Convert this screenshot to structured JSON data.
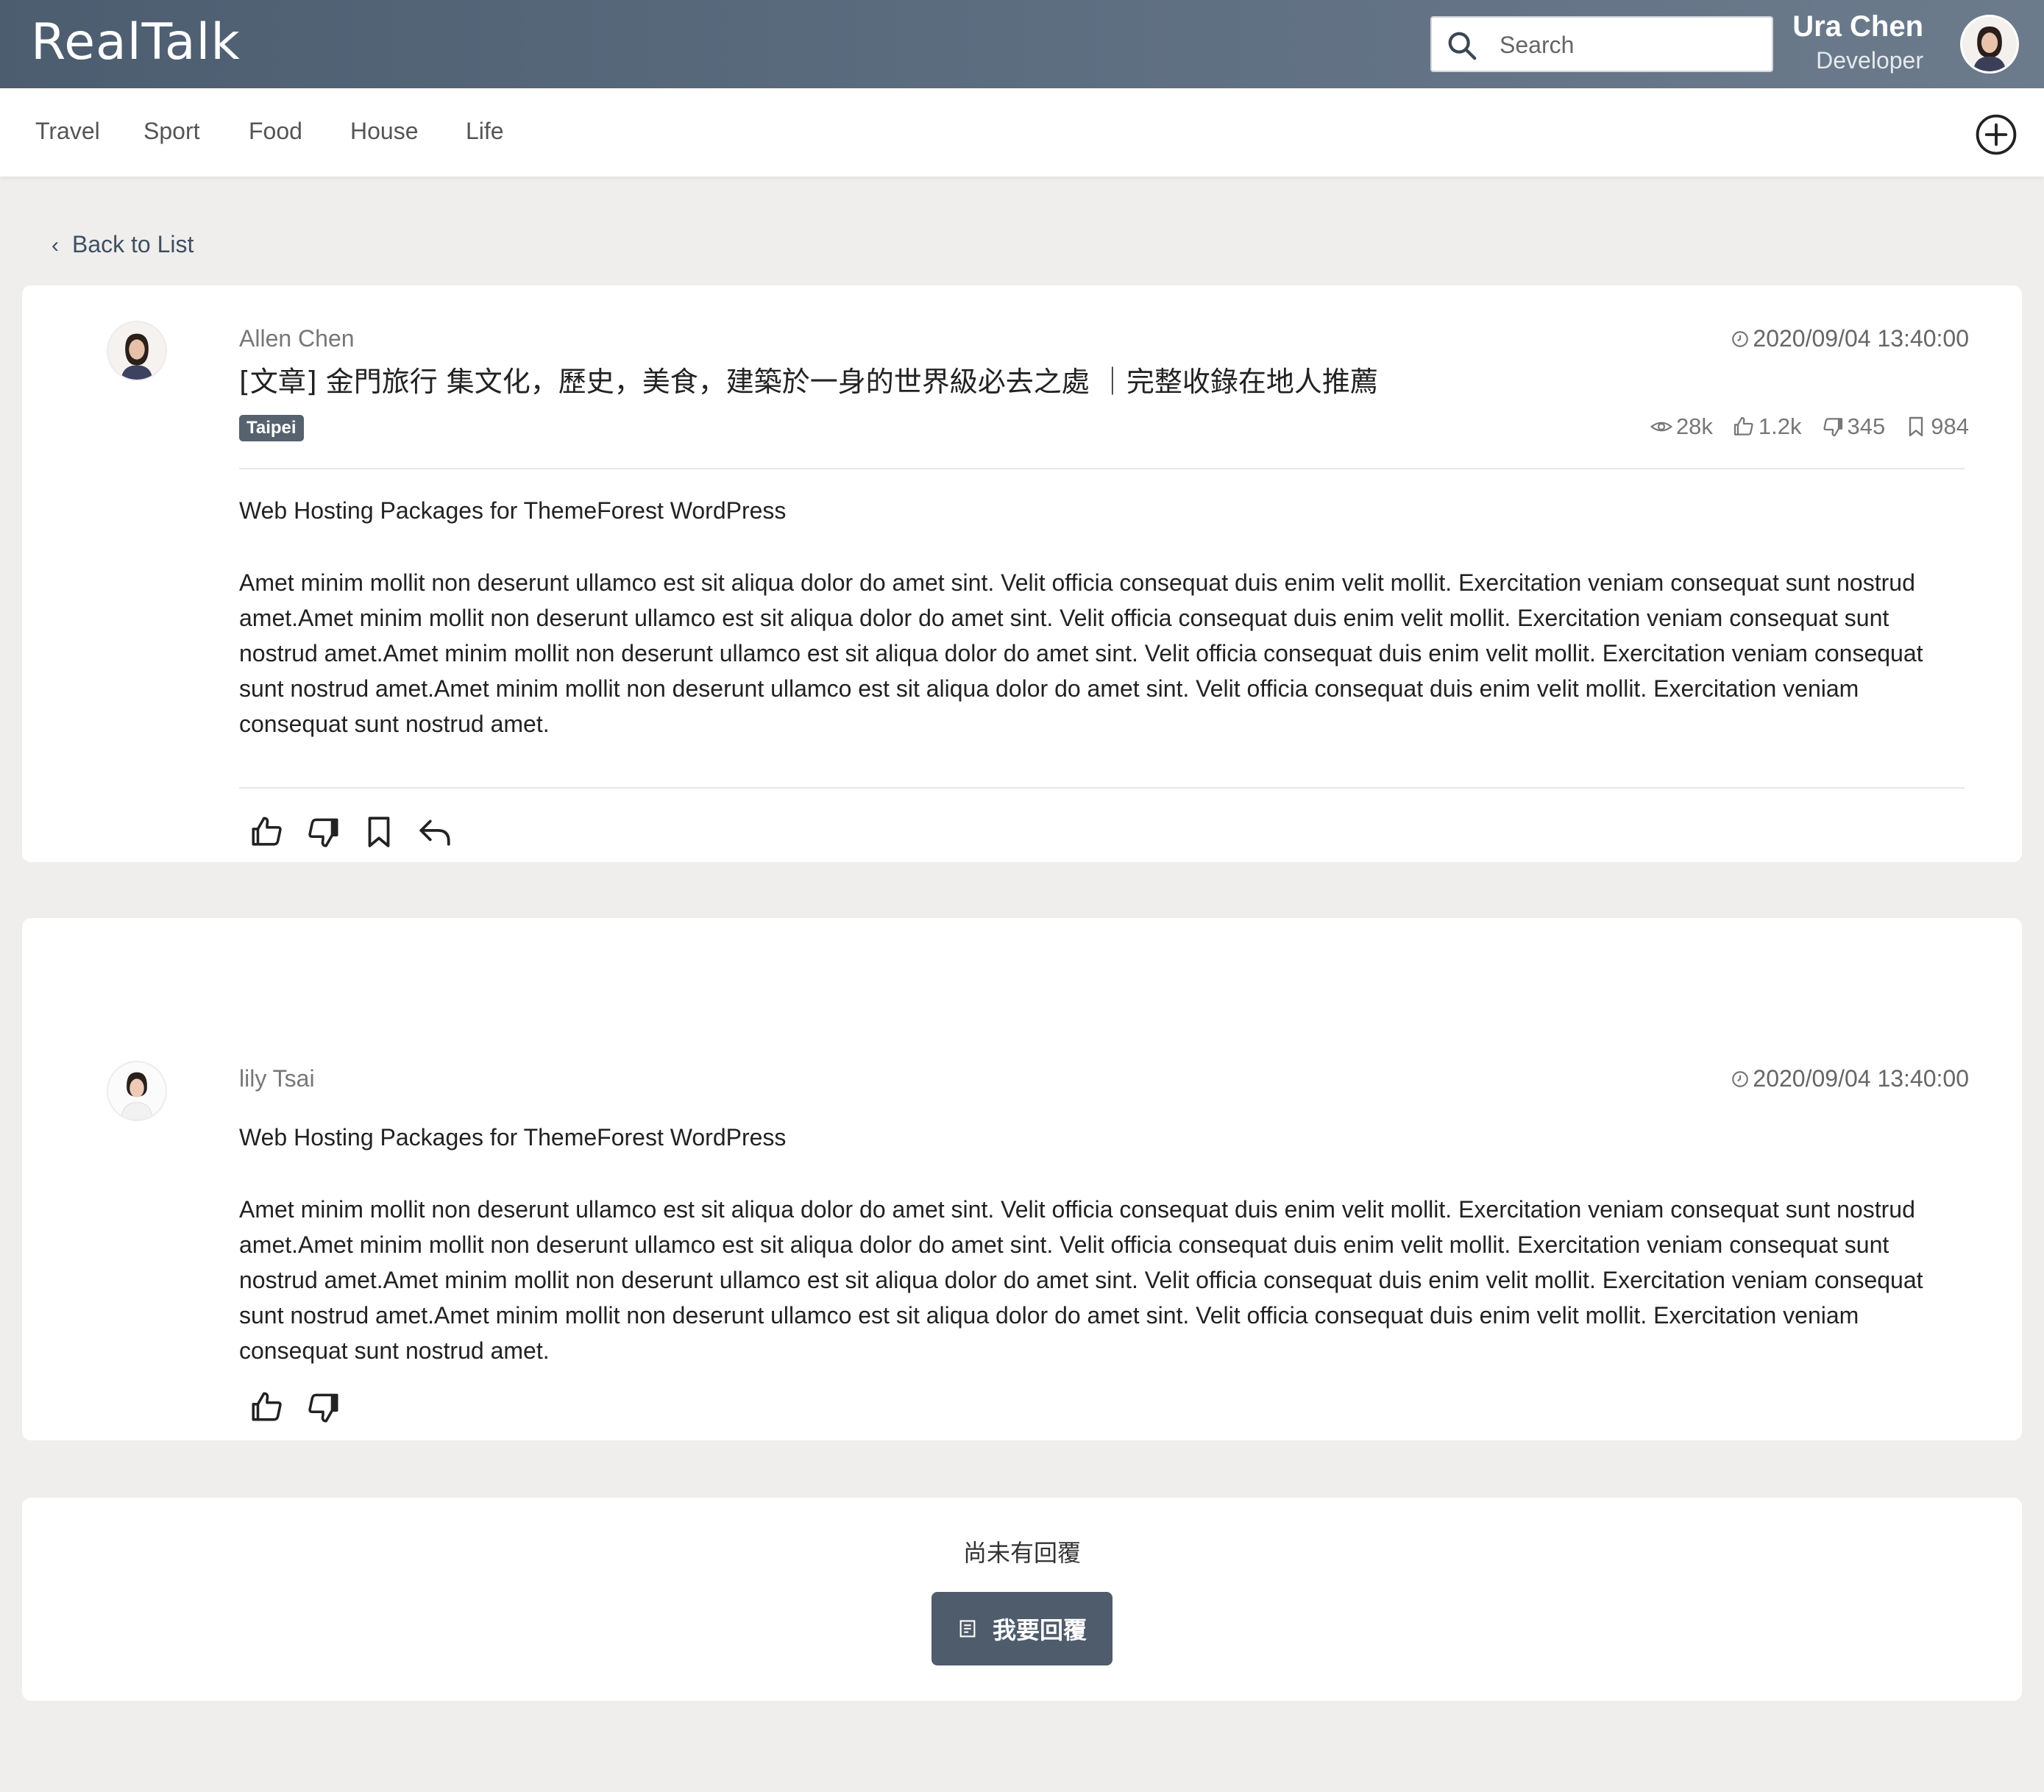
{
  "header": {
    "logo": "RealTalk",
    "search_placeholder": "Search",
    "user_name": "Ura Chen",
    "user_role": "Developer"
  },
  "nav": {
    "items": [
      "Travel",
      "Sport",
      "Food",
      "House",
      "Life"
    ]
  },
  "back_label": "Back to List",
  "post": {
    "author": "Allen Chen",
    "timestamp": "2020/09/04 13:40:00",
    "title": "[文章] 金門旅行 集文化，歷史，美食，建築於一身的世界級必去之處 ｜完整收錄在地人推薦",
    "tag": "Taipei",
    "stats": {
      "views": "28k",
      "likes": "1.2k",
      "dislikes": "345",
      "bookmarks": "984"
    },
    "subtitle": "Web Hosting Packages for ThemeForest WordPress",
    "body": "Amet minim mollit non deserunt ullamco est sit aliqua dolor do amet sint. Velit officia consequat duis enim velit mollit. Exercitation veniam consequat sunt nostrud amet.Amet minim mollit non deserunt ullamco est sit aliqua dolor do amet sint. Velit officia consequat duis enim velit mollit. Exercitation veniam consequat sunt nostrud amet.Amet minim mollit non deserunt ullamco est sit aliqua dolor do amet sint. Velit officia consequat duis enim velit mollit. Exercitation veniam consequat sunt nostrud amet.Amet minim mollit non deserunt ullamco est sit aliqua dolor do amet sint. Velit officia consequat duis enim velit mollit. Exercitation veniam consequat sunt nostrud amet."
  },
  "comment": {
    "author": "lily Tsai",
    "timestamp": "2020/09/04 13:40:00",
    "subtitle": "Web Hosting Packages for ThemeForest WordPress",
    "body": "Amet minim mollit non deserunt ullamco est sit aliqua dolor do amet sint. Velit officia consequat duis enim velit mollit. Exercitation veniam consequat sunt nostrud amet.Amet minim mollit non deserunt ullamco est sit aliqua dolor do amet sint. Velit officia consequat duis enim velit mollit. Exercitation veniam consequat sunt nostrud amet.Amet minim mollit non deserunt ullamco est sit aliqua dolor do amet sint. Velit officia consequat duis enim velit mollit. Exercitation veniam consequat sunt nostrud amet.Amet minim mollit non deserunt ullamco est sit aliqua dolor do amet sint. Velit officia consequat duis enim velit mollit. Exercitation veniam consequat sunt nostrud amet."
  },
  "reply": {
    "empty_text": "尚未有回覆",
    "button_label": "我要回覆"
  },
  "colors": {
    "header_start": "#4d5d70",
    "header_end": "#6c7b8c",
    "accent": "#4e5c6c",
    "background": "#efeeec"
  }
}
